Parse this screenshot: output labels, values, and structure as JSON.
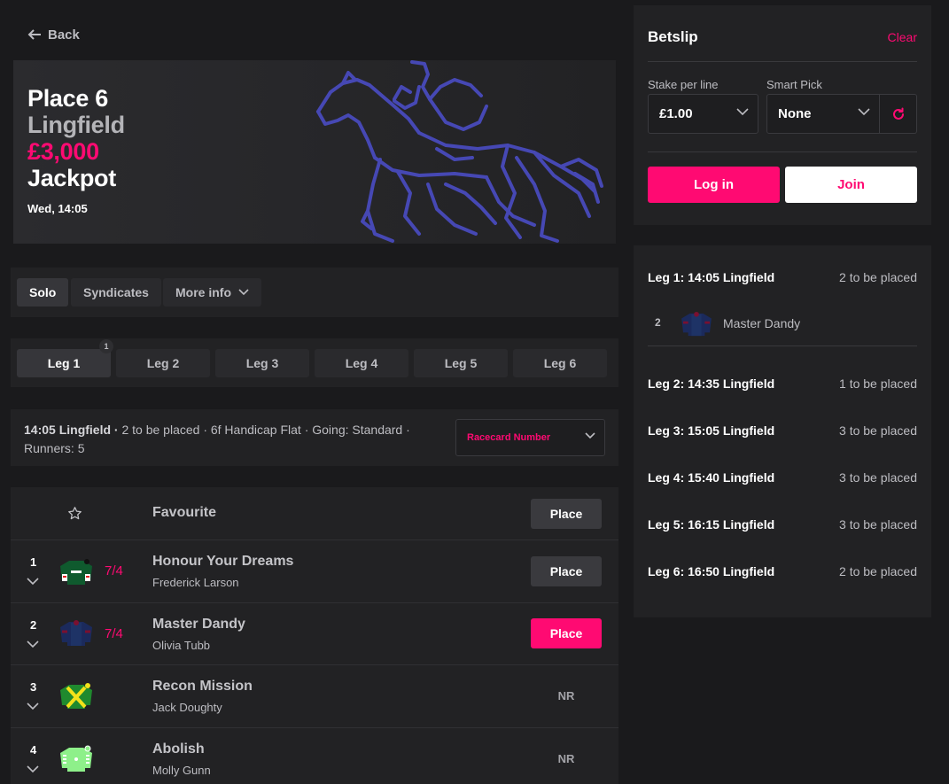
{
  "nav": {
    "back_label": "Back"
  },
  "hero": {
    "line1": "Place 6",
    "line2": "Lingfield",
    "line3": "£3,000",
    "line4": "Jackpot",
    "date": "Wed, 14:05"
  },
  "tabs": [
    {
      "label": "Solo",
      "active": true
    },
    {
      "label": "Syndicates",
      "active": false
    },
    {
      "label": "More info",
      "active": false
    }
  ],
  "legs": [
    {
      "label": "Leg 1",
      "badge": "1",
      "active": true
    },
    {
      "label": "Leg 2"
    },
    {
      "label": "Leg 3"
    },
    {
      "label": "Leg 4"
    },
    {
      "label": "Leg 5"
    },
    {
      "label": "Leg 6"
    }
  ],
  "race": {
    "title": "14:05 Lingfield ·",
    "details": "2 to be placed ·  6f  Handicap  Flat ·  Going: Standard ·",
    "runners": "Runners: 5",
    "sort_label": "Racecard Number"
  },
  "favourite": {
    "label": "Favourite",
    "button": "Place"
  },
  "runners": [
    {
      "number": "1",
      "odds": "7/4",
      "name": "Honour Your Dreams",
      "jockey": "Frederick Larson",
      "action": "Place",
      "selected": false,
      "nr": false
    },
    {
      "number": "2",
      "odds": "7/4",
      "name": "Master Dandy",
      "jockey": "Olivia Tubb",
      "action": "Place",
      "selected": true,
      "nr": false
    },
    {
      "number": "3",
      "odds": "",
      "name": "Recon Mission",
      "jockey": "Jack Doughty",
      "action": "NR",
      "selected": false,
      "nr": true
    },
    {
      "number": "4",
      "odds": "",
      "name": "Abolish",
      "jockey": "Molly Gunn",
      "action": "NR",
      "selected": false,
      "nr": true
    }
  ],
  "betslip": {
    "title": "Betslip",
    "clear": "Clear",
    "stake_label": "Stake per line",
    "stake_value": "£1.00",
    "smart_label": "Smart Pick",
    "smart_value": "None",
    "login": "Log in",
    "join": "Join"
  },
  "slip_legs": [
    {
      "title": "Leg 1: 14:05 Lingfield",
      "places": "2 to be placed"
    },
    {
      "title": "Leg 2: 14:35 Lingfield",
      "places": "1 to be placed"
    },
    {
      "title": "Leg 3: 15:05 Lingfield",
      "places": "3 to be placed"
    },
    {
      "title": "Leg 4: 15:40 Lingfield",
      "places": "3 to be placed"
    },
    {
      "title": "Leg 5: 16:15 Lingfield",
      "places": "3 to be placed"
    },
    {
      "title": "Leg 6: 16:50 Lingfield",
      "places": "2 to be placed"
    }
  ],
  "slip_selection": {
    "number": "2",
    "name": "Master Dandy"
  },
  "colors": {
    "accent": "#ff0a72",
    "horse": "#4648b4",
    "panel": "#222224",
    "background": "#1a1a1c"
  },
  "icons": [
    "arrow-left-icon",
    "horse-logo",
    "chevron-down-icon",
    "star-icon",
    "refresh-icon",
    "jockey-silk-icon"
  ]
}
